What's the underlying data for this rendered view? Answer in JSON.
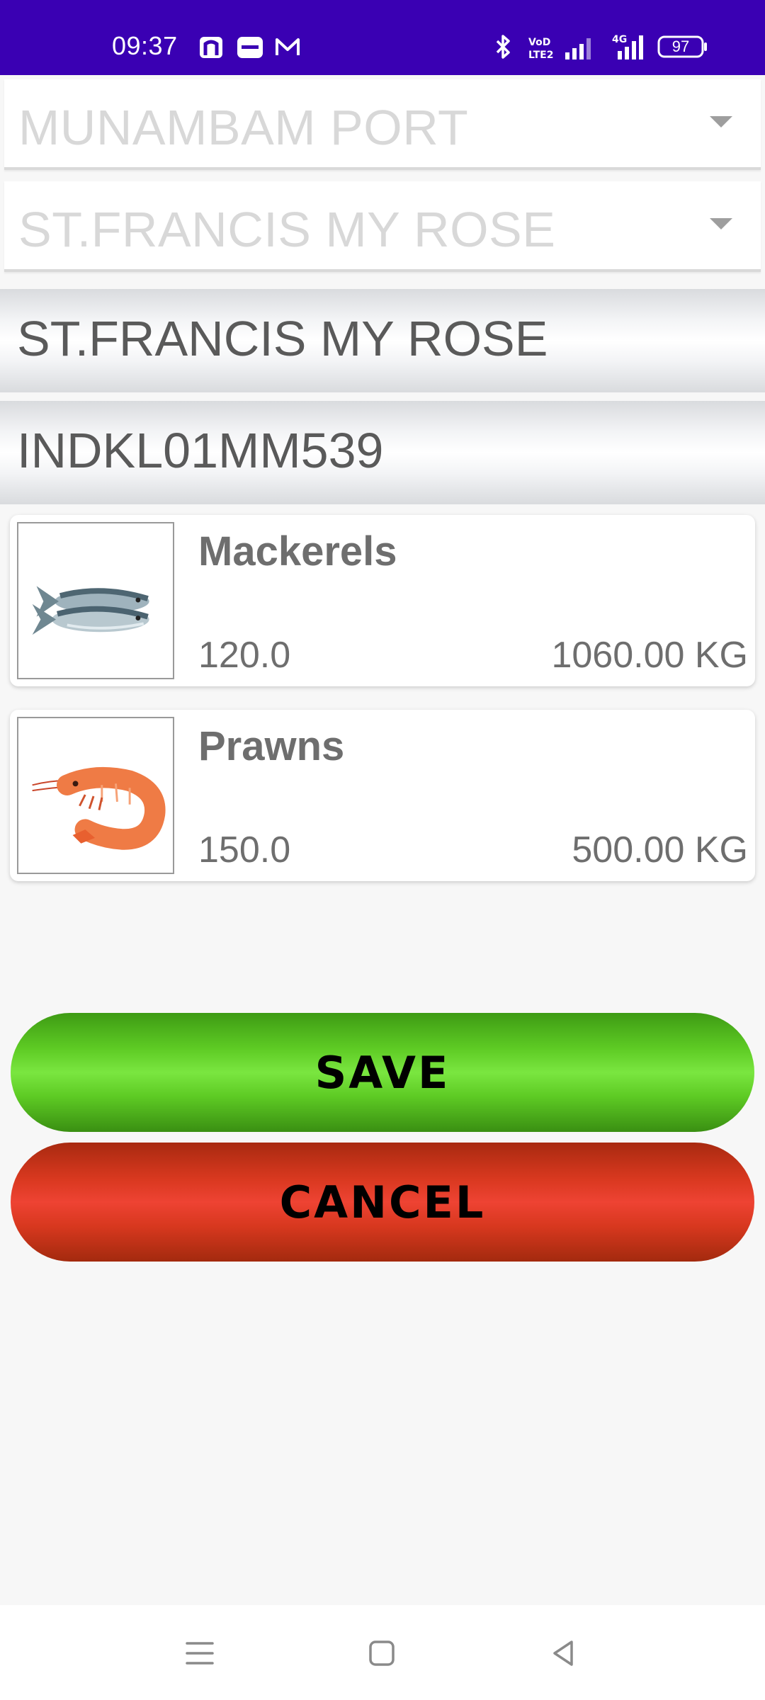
{
  "status_bar": {
    "time": "09:37",
    "battery": "97",
    "icons": [
      "paytm-hand-icon",
      "paytm-icon",
      "gmail-icon",
      "bluetooth-icon",
      "volte-icon",
      "signal-icon",
      "4g-signal-icon",
      "battery-icon"
    ]
  },
  "selectors": {
    "port": {
      "value": "MUNAMBAM PORT"
    },
    "vessel": {
      "value": "ST.FRANCIS MY ROSE"
    }
  },
  "vessel_info": {
    "name": "ST.FRANCIS MY ROSE",
    "registration": "INDKL01MM539"
  },
  "catches": [
    {
      "name": "Mackerels",
      "price": "120.0",
      "weight": "1060.00 KG",
      "image": "mackerel-image"
    },
    {
      "name": "Prawns",
      "price": "150.0",
      "weight": "500.00 KG",
      "image": "prawn-image"
    }
  ],
  "buttons": {
    "save": "SAVE",
    "cancel": "CANCEL"
  },
  "colors": {
    "status_bar": "#3a00b3",
    "save": "#5ecb24",
    "cancel": "#d8381f"
  }
}
